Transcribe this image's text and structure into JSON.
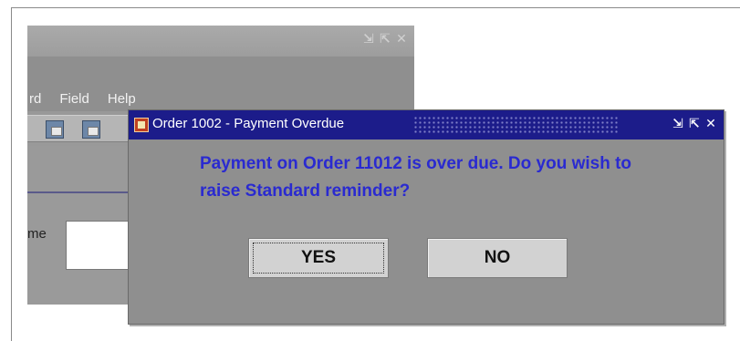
{
  "background_window": {
    "menu": [
      "rd",
      "Field",
      "Help"
    ],
    "field_label_fragment": "me",
    "controls": [
      "⇲",
      "⇱",
      "✕"
    ]
  },
  "dialog": {
    "title": "Order 1002 - Payment Overdue",
    "message": "Payment on Order 11012 is over due. Do you wish to raise Standard reminder?",
    "buttons": {
      "yes": "YES",
      "no": "NO"
    },
    "controls": [
      "⇲",
      "⇱",
      "✕"
    ],
    "colors": {
      "titlebar": "#1c1c8a",
      "message": "#2a2ad0",
      "body": "#8f8f8f"
    }
  }
}
